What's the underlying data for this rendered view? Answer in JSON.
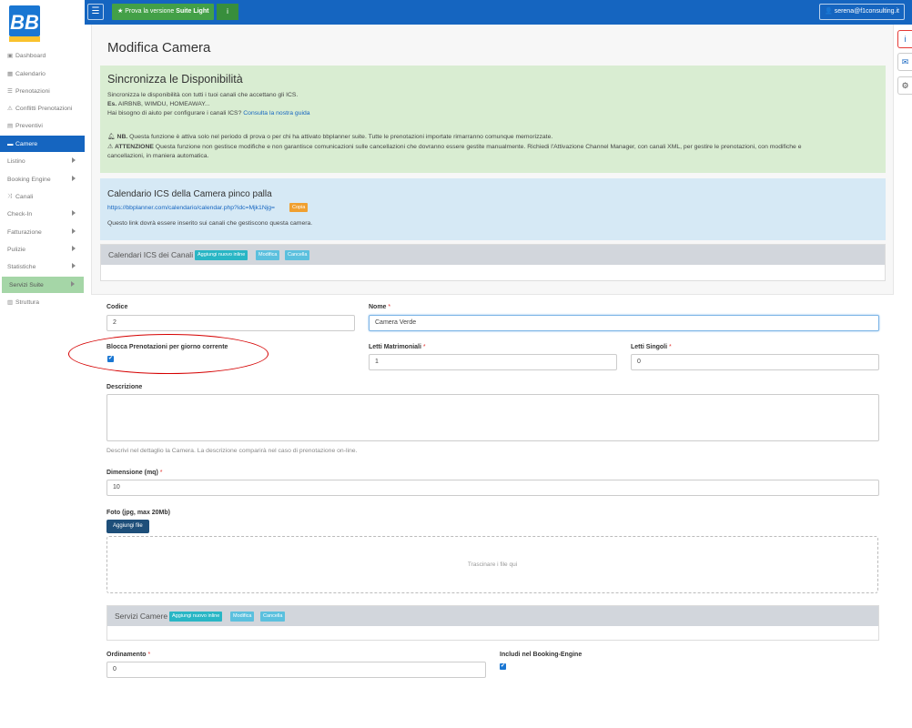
{
  "sidebar": {
    "logo_text": "BB",
    "items": [
      {
        "label": "Dashboard",
        "icon": "dashboard-icon",
        "glyph": "▣"
      },
      {
        "label": "Calendario",
        "icon": "calendar-icon",
        "glyph": "▦"
      },
      {
        "label": "Prenotazioni",
        "icon": "list-icon",
        "glyph": "☰"
      },
      {
        "label": "Conflitti Prenotazioni",
        "icon": "warning-icon",
        "glyph": "⚠"
      },
      {
        "label": "Preventivi",
        "icon": "document-icon",
        "glyph": "▤"
      },
      {
        "label": "Camere",
        "icon": "bed-icon",
        "glyph": "▬"
      },
      {
        "label": "Listino",
        "icon": "",
        "glyph": ""
      },
      {
        "label": "Booking Engine",
        "icon": "",
        "glyph": ""
      },
      {
        "label": "Canali",
        "icon": "shuffle-icon",
        "glyph": "⤨"
      },
      {
        "label": "Check-In",
        "icon": "",
        "glyph": ""
      },
      {
        "label": "Fatturazione",
        "icon": "",
        "glyph": ""
      },
      {
        "label": "Pulizie",
        "icon": "",
        "glyph": ""
      },
      {
        "label": "Statistiche",
        "icon": "",
        "glyph": ""
      },
      {
        "label": "Servizi Suite",
        "icon": "",
        "glyph": ""
      },
      {
        "label": "Struttura",
        "icon": "building-icon",
        "glyph": "▥"
      }
    ]
  },
  "topbar": {
    "menu_glyph": "☰",
    "trial_prefix": "Prova la versione",
    "trial_bold": "Suite Light",
    "trial_star": "★",
    "info_glyph": "i",
    "user_glyph": "👤",
    "user_email": "serena@f1consulting.it"
  },
  "floating": {
    "info": "i",
    "mail": "✉",
    "gear": "⚙"
  },
  "page": {
    "title": "Modifica Camera"
  },
  "sync_panel": {
    "title": "Sincronizza le Disponibilità",
    "line1": "Sincronizza le disponibilità con tutti i tuoi canali che accettano gli ICS.",
    "example_bold": "Es.",
    "example_text": "AIRBNB, WIMDU, HOMEAWAY...",
    "help_text": "Hai bisogno di aiuto per configurare i canali ICS?",
    "help_link": "Consulta la nostra guida",
    "nb_bold": "NB.",
    "nb_text": "Questa funzione è attiva solo nel periodo di prova o per chi ha attivato bbplanner suite. Tutte le prenotazioni importate rimarranno comunque memorizzate.",
    "warn_bold": "ATTENZIONE",
    "warn_text": "Questa funzione non gestisce modifiche e non garantisce comunicazioni sulle cancellazioni che dovranno essere gestite manualmente. Richiedi l'Attivazione Channel Manager, con canali XML, per gestire le prenotazioni, con modifiche e",
    "warn_text2": "cancellazioni, in maniera automatica."
  },
  "ics_panel": {
    "title": "Calendario ICS della Camera pinco palla",
    "link": "https://bbplanner.com/calendario/calendar.php?idc=Mjk1Njg=",
    "copy_label": "Copia",
    "note": "Questo link dovrà essere inserito sui canali che gestiscono questa camera."
  },
  "channels_panel": {
    "title": "Calendari ICS dei Canali",
    "add_label": "Aggiungi nuovo inline",
    "edit_label": "Modifica",
    "delete_label": "Cancella"
  },
  "form": {
    "codice_label": "Codice",
    "codice_value": "2",
    "nome_label": "Nome",
    "nome_value": "Camera Verde",
    "blocca_label": "Blocca Prenotazioni per giorno corrente",
    "blocca_checked": true,
    "letti_matr_label": "Letti Matrimoniali",
    "letti_matr_value": "1",
    "letti_sing_label": "Letti Singoli",
    "letti_sing_value": "0",
    "descrizione_label": "Descrizione",
    "descrizione_value": "",
    "descrizione_help": "Descrivi nel dettaglio la Camera. La descrizione comparirà nel caso di prenotazione on-line.",
    "dimensione_label": "Dimensione (mq)",
    "dimensione_value": "10",
    "foto_label": "Foto (jpg, max 20Mb)",
    "add_file_label": "Aggiungi file",
    "dropzone_text": "Trascinare i file qui",
    "ordinamento_label": "Ordinamento",
    "ordinamento_value": "0",
    "booking_label": "Includi nel Booking-Engine",
    "booking_checked": true,
    "required_mark": "*",
    "check_glyph": "✔"
  },
  "services_panel": {
    "title": "Servizi Camere",
    "add_label": "Aggiungi nuovo inline",
    "edit_label": "Modifica",
    "delete_label": "Cancella"
  },
  "colors": {
    "primary": "#1565c0",
    "success": "#43a047",
    "annotation": "#d50000"
  }
}
